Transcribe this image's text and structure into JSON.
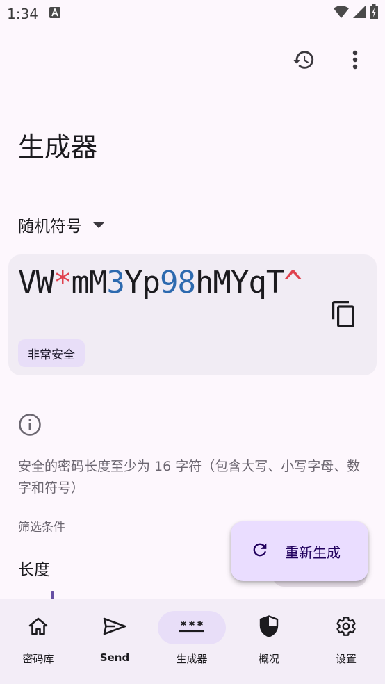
{
  "status_bar": {
    "time": "1:34",
    "icons": [
      "a-notification-icon",
      "wifi-icon",
      "signal-icon",
      "battery-icon"
    ]
  },
  "top_bar": {
    "actions": [
      "history-icon",
      "more-vert-icon"
    ]
  },
  "page": {
    "title": "生成器"
  },
  "generator_type": {
    "selected": "随机符号"
  },
  "password": {
    "segments": [
      {
        "text": "VW",
        "kind": "letter"
      },
      {
        "text": "*",
        "kind": "special"
      },
      {
        "text": "mM",
        "kind": "letter"
      },
      {
        "text": "3",
        "kind": "digit"
      },
      {
        "text": "Yp",
        "kind": "letter"
      },
      {
        "text": "98",
        "kind": "digit"
      },
      {
        "text": "hMYqT",
        "kind": "letter"
      },
      {
        "text": "^",
        "kind": "special"
      }
    ],
    "strength": "非常安全"
  },
  "info": {
    "text": "安全的密码长度至少为 16 字符（包含大写、小写字母、数字和符号）"
  },
  "filters": {
    "label": "筛选条件",
    "length_label": "长度"
  },
  "fab": {
    "label": "重新生成"
  },
  "bottom_nav": {
    "items": [
      {
        "label": "密码库",
        "icon": "home-icon",
        "active": false
      },
      {
        "label": "Send",
        "icon": "send-icon",
        "active": false
      },
      {
        "label": "生成器",
        "icon": "password-icon",
        "active": true
      },
      {
        "label": "概况",
        "icon": "shield-icon",
        "active": false
      },
      {
        "label": "设置",
        "icon": "gear-icon",
        "active": false
      }
    ]
  },
  "colors": {
    "background": "#fdf7fd",
    "card": "#f1ecf4",
    "accent": "#6750a4",
    "special_char": "#e0414e",
    "digit_char": "#2d6aaf",
    "fab": "#eaddff",
    "nav_active": "#e8def8"
  }
}
